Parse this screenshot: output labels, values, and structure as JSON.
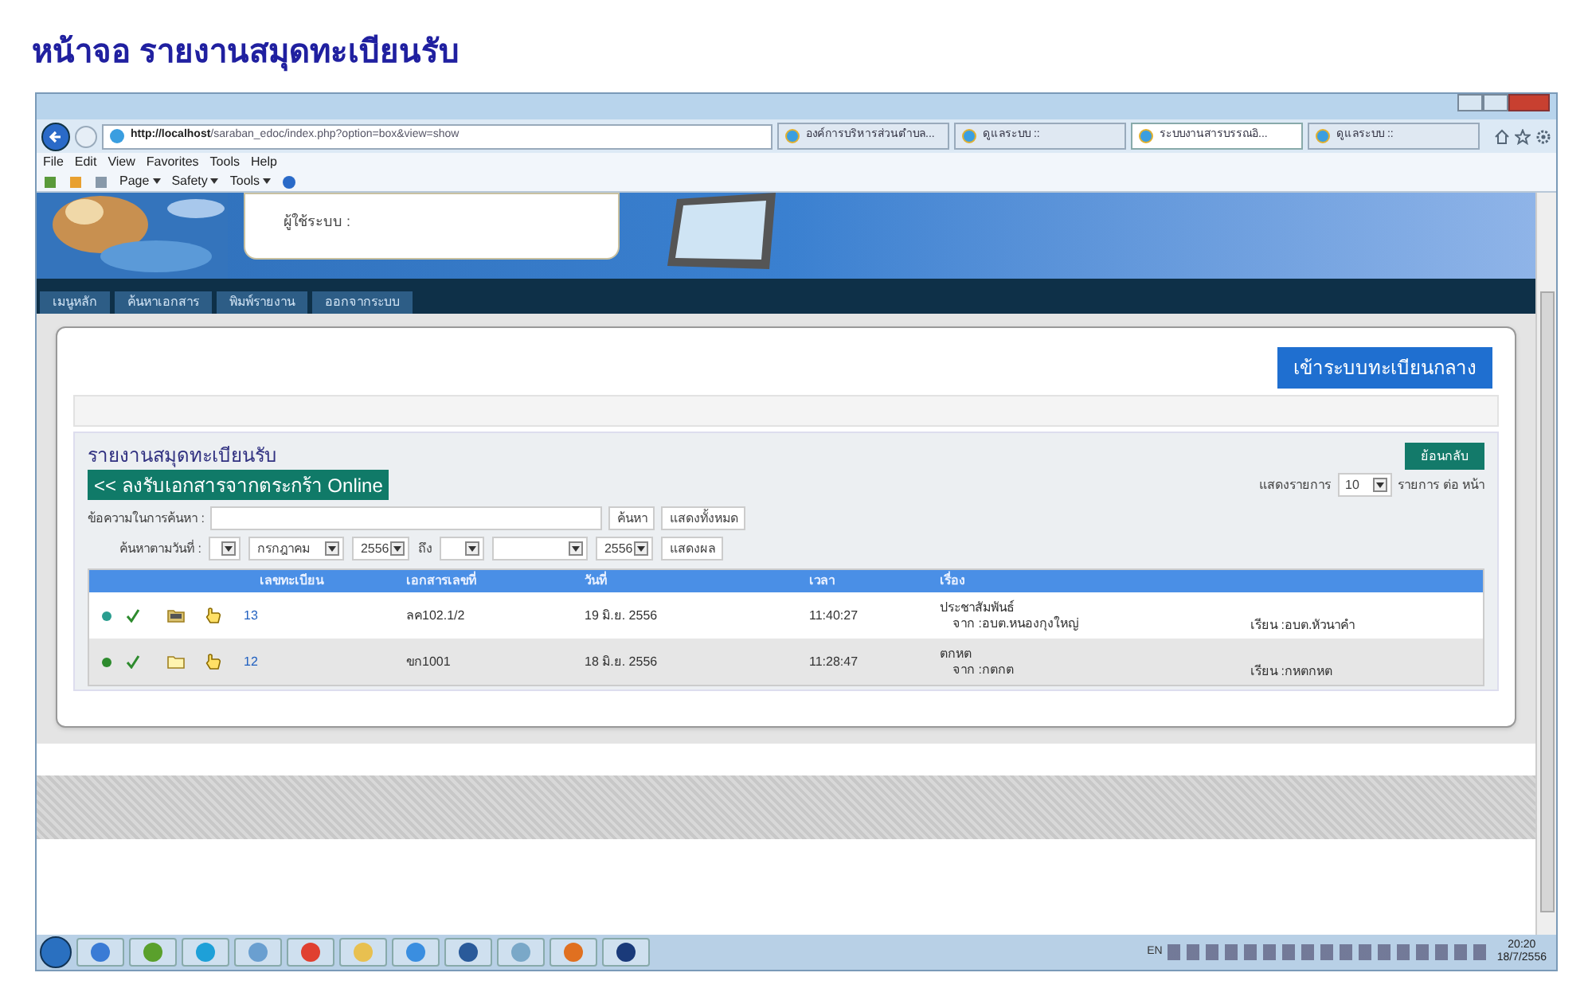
{
  "doc_title": "หน้าจอ รายงานสมุดทะเบียนรับ",
  "browser": {
    "url_host": "http://localhost",
    "url_path": "/saraban_edoc/index.php?option=box&view=show",
    "tabs": [
      {
        "label": "องค์การบริหารส่วนตำบล...",
        "selected": false
      },
      {
        "label": "ดูแลระบบ ::",
        "selected": false
      },
      {
        "label": "ระบบงานสารบรรณอิ...",
        "selected": true
      },
      {
        "label": "ดูแลระบบ ::",
        "selected": false
      }
    ],
    "menu": [
      "File",
      "Edit",
      "View",
      "Favorites",
      "Tools",
      "Help"
    ],
    "commands": [
      "Page",
      "Safety",
      "Tools"
    ]
  },
  "site": {
    "user_label": "ผู้ใช้ระบบ :",
    "nav": [
      "เมนูหลัก",
      "ค้นหาเอกสาร",
      "พิมพ์รายงาน",
      "ออกจากระบบ"
    ]
  },
  "central_button": "เข้าระบบทะเบียนกลาง",
  "report": {
    "title": "รายงานสมุดทะเบียนรับ",
    "online_button": "<< ลงรับเอกสารจากตระกร้า Online",
    "back_button": "ย้อนกลับ",
    "per_page": {
      "label_before": "แสดงรายการ",
      "value": "10",
      "label_after": "รายการ ต่อ หน้า"
    },
    "search": {
      "label": "ข้อความในการค้นหา :",
      "search_button": "ค้นหา",
      "show_all_button": "แสดงทั้งหมด"
    },
    "date_filter": {
      "label": "ค้นหาตามวันที่ :",
      "month_from": "กรกฎาคม",
      "year_from": "2556",
      "connector": "ถึง",
      "year_to": "2556",
      "show_button": "แสดงผล"
    },
    "table": {
      "columns": [
        "เลขทะเบียน",
        "เอกสารเลขที่",
        "วันที่",
        "เวลา",
        "เรื่อง"
      ],
      "rows": [
        {
          "color": "#2a9d8f",
          "number": "13",
          "doc_no": "ลค102.1/2",
          "date": "19 มิ.ย. 2556",
          "time": "11:40:27",
          "subject": "ประชาสัมพันธ์",
          "from": "จาก :อบต.หนองกุงใหญ่",
          "to": "เรียน :อบต.หัวนาคำ",
          "folder_filled": true
        },
        {
          "color": "#2e8b2e",
          "number": "12",
          "doc_no": "ขก1001",
          "date": "18 มิ.ย. 2556",
          "time": "11:28:47",
          "subject": "ตกหต",
          "from": "จาก :กตกต",
          "to": "เรียน :กหตกหต",
          "folder_filled": false
        }
      ]
    }
  },
  "taskbar": {
    "language": "EN",
    "time": "20:20",
    "date": "18/7/2556"
  }
}
